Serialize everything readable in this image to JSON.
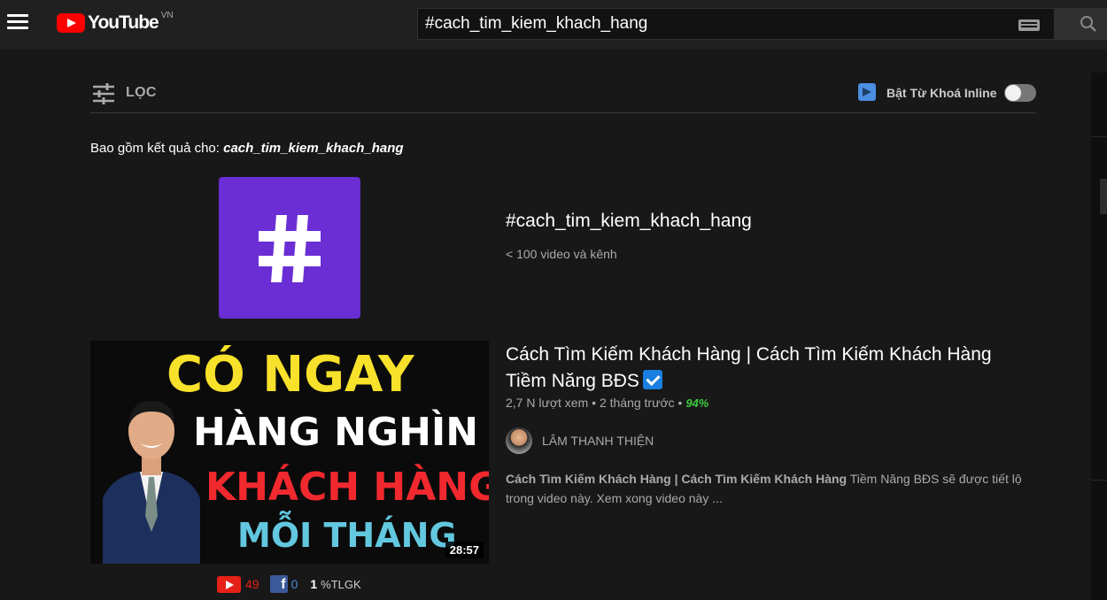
{
  "header": {
    "logo_text": "YouTube",
    "logo_country": "VN",
    "search_value": "#cach_tim_kiem_khach_hang",
    "icons": [
      "menu-icon",
      "youtube-logo-icon",
      "keyboard-icon",
      "search-icon"
    ]
  },
  "filter": {
    "label": "LỌC",
    "inline_toggle_label": "Bật Từ Khoá Inline",
    "inline_toggle_on": false
  },
  "include": {
    "prefix": "Bao gồm kết quả cho: ",
    "term": "cach_tim_kiem_khach_hang"
  },
  "hashtag_result": {
    "title": "#cach_tim_kiem_khach_hang",
    "subtitle": "< 100 video và kênh",
    "thumb_color": "#6a2ed4"
  },
  "video": {
    "thumbnail_lines": [
      "CÓ NGAY",
      "HÀNG NGHÌN",
      "KHÁCH HÀNG",
      "MỖI THÁNG"
    ],
    "duration": "28:57",
    "title": "Cách Tìm Kiếm Khách Hàng | Cách Tìm Kiếm Khách Hàng Tiềm Năng BĐS",
    "views": "2,7 N lượt xem",
    "age": "2 tháng trước",
    "percent": "94%",
    "channel": "LÂM THANH THIỆN",
    "description_bold": "Cách Tìm Kiếm Khách Hàng | Cách Tìm Kiếm Khách Hàng",
    "description_rest": " Tiềm Năng BĐS sẽ được tiết lộ trong video này. Xem xong video này ...",
    "stats": {
      "youtube_count": "49",
      "facebook_count": "0",
      "tlgk_value": "1",
      "tlgk_label": "%TLGK"
    }
  },
  "colors": {
    "background": "#181818",
    "topbar": "#202020",
    "accent_red": "#ff0000",
    "percent_green": "#3ec93e"
  }
}
